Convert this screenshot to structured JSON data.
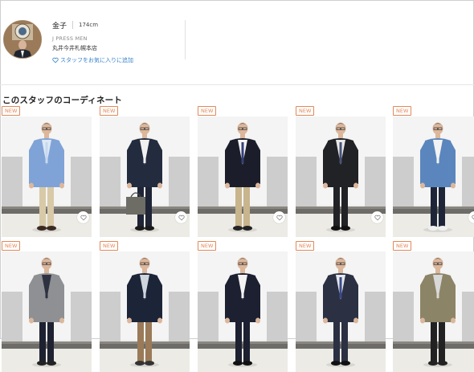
{
  "staff": {
    "name": "金子",
    "height": "174cm",
    "brand": "J PRESS MEN",
    "shop": "丸井今井札幌本店",
    "favorite_label": "スタッフをお気に入りに追加"
  },
  "section": {
    "title": "このスタッフのコーディネート"
  },
  "coordinates": [
    {
      "badge": "NEW",
      "jacket": "#7fa3d6",
      "top": "#dde8f5",
      "tie": "#c7d8ee",
      "pants": "#d8caa8",
      "shoes": "#3a2a22",
      "bag": false
    },
    {
      "badge": "NEW",
      "jacket": "#232c3e",
      "top": "#f1f1f1",
      "tie": "#f1f1f1",
      "pants": "#1f2536",
      "shoes": "#1b1b1b",
      "bag": true
    },
    {
      "badge": "NEW",
      "jacket": "#1b1e2a",
      "top": "#f5f5f5",
      "tie": "#35407a",
      "pants": "#c8b48d",
      "shoes": "#222",
      "bag": false
    },
    {
      "badge": "NEW",
      "jacket": "#202225",
      "top": "#e9e9e9",
      "tie": "#4a5278",
      "pants": "#202225",
      "shoes": "#111",
      "bag": false
    },
    {
      "badge": "NEW",
      "jacket": "#5a86bd",
      "top": "#f3f3f3",
      "tie": "#f3f3f3",
      "pants": "#1f2538",
      "shoes": "#f1f1f1",
      "bag": false
    },
    {
      "badge": "NEW",
      "jacket": "#8e9093",
      "top": "#2e3240",
      "tie": "#2e3240",
      "pants": "#1e2230",
      "shoes": "#222",
      "bag": false
    },
    {
      "badge": "NEW",
      "jacket": "#1c2438",
      "top": "#cfd6dd",
      "tie": "#cfd6dd",
      "pants": "#9a7a58",
      "shoes": "#333",
      "bag": false
    },
    {
      "badge": "NEW",
      "jacket": "#1c2030",
      "top": "#f3f3f3",
      "tie": "#f3f3f3",
      "pants": "#1c2030",
      "shoes": "#111",
      "bag": false
    },
    {
      "badge": "NEW",
      "jacket": "#2b3142",
      "top": "#e4e8ee",
      "tie": "#3b4a8a",
      "pants": "#2b3142",
      "shoes": "#111",
      "bag": false
    },
    {
      "badge": "NEW",
      "jacket": "#8c8466",
      "top": "#d9d9d9",
      "tie": "#d9d9d9",
      "pants": "#222",
      "shoes": "#222",
      "bag": false
    }
  ]
}
